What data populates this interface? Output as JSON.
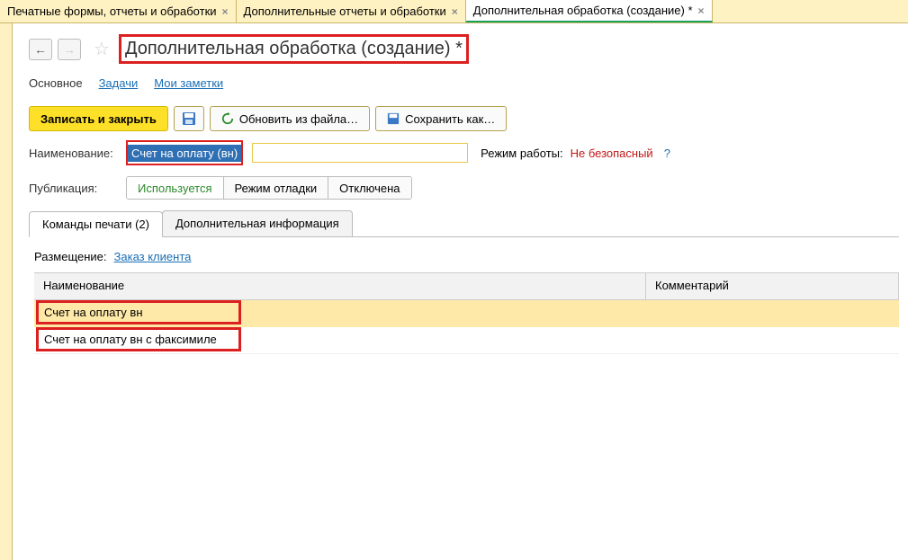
{
  "top_tabs": [
    {
      "label": "Печатные формы, отчеты и обработки",
      "active": false
    },
    {
      "label": "Дополнительные отчеты и обработки",
      "active": false
    },
    {
      "label": "Дополнительная обработка (создание) *",
      "active": true
    }
  ],
  "page_title": "Дополнительная обработка (создание) *",
  "sections": {
    "main": "Основное",
    "tasks": "Задачи",
    "notes": "Мои заметки"
  },
  "toolbar": {
    "save_close": "Записать и закрыть",
    "update_from_file": "Обновить из файла…",
    "save_as": "Сохранить как…"
  },
  "fields": {
    "name_label": "Наименование:",
    "name_value": "Счет на оплату (вн)",
    "mode_label": "Режим работы:",
    "mode_value": "Не безопасный",
    "publish_label": "Публикация:"
  },
  "publish_options": {
    "used": "Используется",
    "debug": "Режим отладки",
    "disabled": "Отключена"
  },
  "inner_tabs": {
    "print_commands": "Команды печати (2)",
    "extra_info": "Дополнительная информация"
  },
  "placement": {
    "label": "Размещение:",
    "link": "Заказ клиента"
  },
  "grid": {
    "headers": {
      "name": "Наименование",
      "comment": "Комментарий"
    },
    "rows": [
      {
        "name": "Счет на оплату вн",
        "comment": "",
        "selected": true
      },
      {
        "name": "Счет на оплату вн с факсимиле",
        "comment": "",
        "selected": false
      }
    ]
  }
}
